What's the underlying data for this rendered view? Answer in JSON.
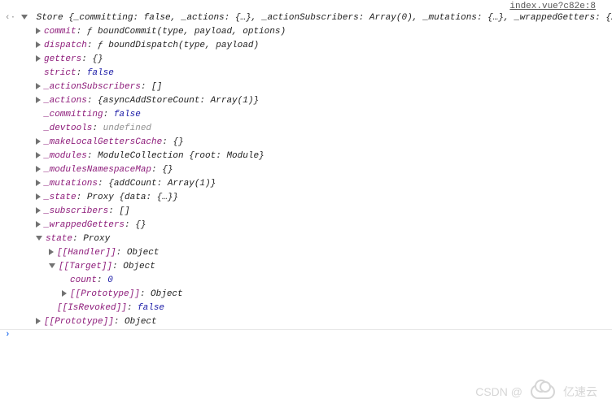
{
  "source": "index.vue?c82e:8",
  "header": "Store {_committing: false, _actions: {…}, _actionSubscribers: Array(0), _mutations: {…}, _wrappedGetters: {…}, …}",
  "info_badge": "i",
  "rows": [
    {
      "expand": "right",
      "indent": 1,
      "key": "commit",
      "sep": ": ",
      "valClass": "summary",
      "val": "ƒ boundCommit(type, payload, options)"
    },
    {
      "expand": "right",
      "indent": 1,
      "key": "dispatch",
      "sep": ": ",
      "valClass": "summary",
      "val": "ƒ boundDispatch(type, payload)"
    },
    {
      "expand": "right",
      "indent": 1,
      "key": "getters",
      "sep": ": ",
      "valClass": "summary",
      "val": "{}"
    },
    {
      "expand": "none",
      "indent": 1,
      "key": "strict",
      "sep": ": ",
      "valClass": "val-kw",
      "val": "false"
    },
    {
      "expand": "right",
      "indent": 1,
      "key": "_actionSubscribers",
      "sep": ": ",
      "valClass": "summary",
      "val": "[]"
    },
    {
      "expand": "right",
      "indent": 1,
      "key": "_actions",
      "sep": ": ",
      "valClass": "summary",
      "val": "{asyncAddStoreCount: Array(1)}"
    },
    {
      "expand": "none",
      "indent": 1,
      "key": "_committing",
      "sep": ": ",
      "valClass": "val-kw",
      "val": "false"
    },
    {
      "expand": "none",
      "indent": 1,
      "key": "_devtools",
      "sep": ": ",
      "valClass": "val-gray",
      "val": "undefined"
    },
    {
      "expand": "right",
      "indent": 1,
      "key": "_makeLocalGettersCache",
      "sep": ": ",
      "valClass": "summary",
      "val": "{}"
    },
    {
      "expand": "right",
      "indent": 1,
      "key": "_modules",
      "sep": ": ",
      "valClass": "summary",
      "val": "ModuleCollection {root: Module}"
    },
    {
      "expand": "right",
      "indent": 1,
      "key": "_modulesNamespaceMap",
      "sep": ": ",
      "valClass": "summary",
      "val": "{}"
    },
    {
      "expand": "right",
      "indent": 1,
      "key": "_mutations",
      "sep": ": ",
      "valClass": "summary",
      "val": "{addCount: Array(1)}"
    },
    {
      "expand": "right",
      "indent": 1,
      "key": "_state",
      "sep": ": ",
      "valClass": "summary",
      "val": "Proxy {data: {…}}"
    },
    {
      "expand": "right",
      "indent": 1,
      "key": "_subscribers",
      "sep": ": ",
      "valClass": "summary",
      "val": "[]"
    },
    {
      "expand": "right",
      "indent": 1,
      "key": "_wrappedGetters",
      "sep": ": ",
      "valClass": "summary",
      "val": "{}"
    },
    {
      "expand": "down",
      "indent": 1,
      "key": "state",
      "sep": ": ",
      "valClass": "summary",
      "val": "Proxy"
    },
    {
      "expand": "right",
      "indent": 2,
      "key": "[[Handler]]",
      "sep": ": ",
      "valClass": "summary",
      "val": "Object"
    },
    {
      "expand": "down",
      "indent": 2,
      "key": "[[Target]]",
      "sep": ": ",
      "valClass": "summary",
      "val": "Object"
    },
    {
      "expand": "none",
      "indent": 3,
      "key": "count",
      "sep": ": ",
      "valClass": "val-num",
      "val": "0"
    },
    {
      "expand": "right",
      "indent": 3,
      "key": "[[Prototype]]",
      "sep": ": ",
      "valClass": "summary",
      "val": "Object"
    },
    {
      "expand": "none",
      "indent": 2,
      "key": "[[IsRevoked]]",
      "sep": ": ",
      "valClass": "val-kw",
      "val": "false"
    },
    {
      "expand": "right",
      "indent": 1,
      "key": "[[Prototype]]",
      "sep": ": ",
      "valClass": "summary",
      "val": "Object"
    }
  ],
  "prompt": "›",
  "watermark": {
    "left": "CSDN @",
    "right": "亿速云"
  }
}
